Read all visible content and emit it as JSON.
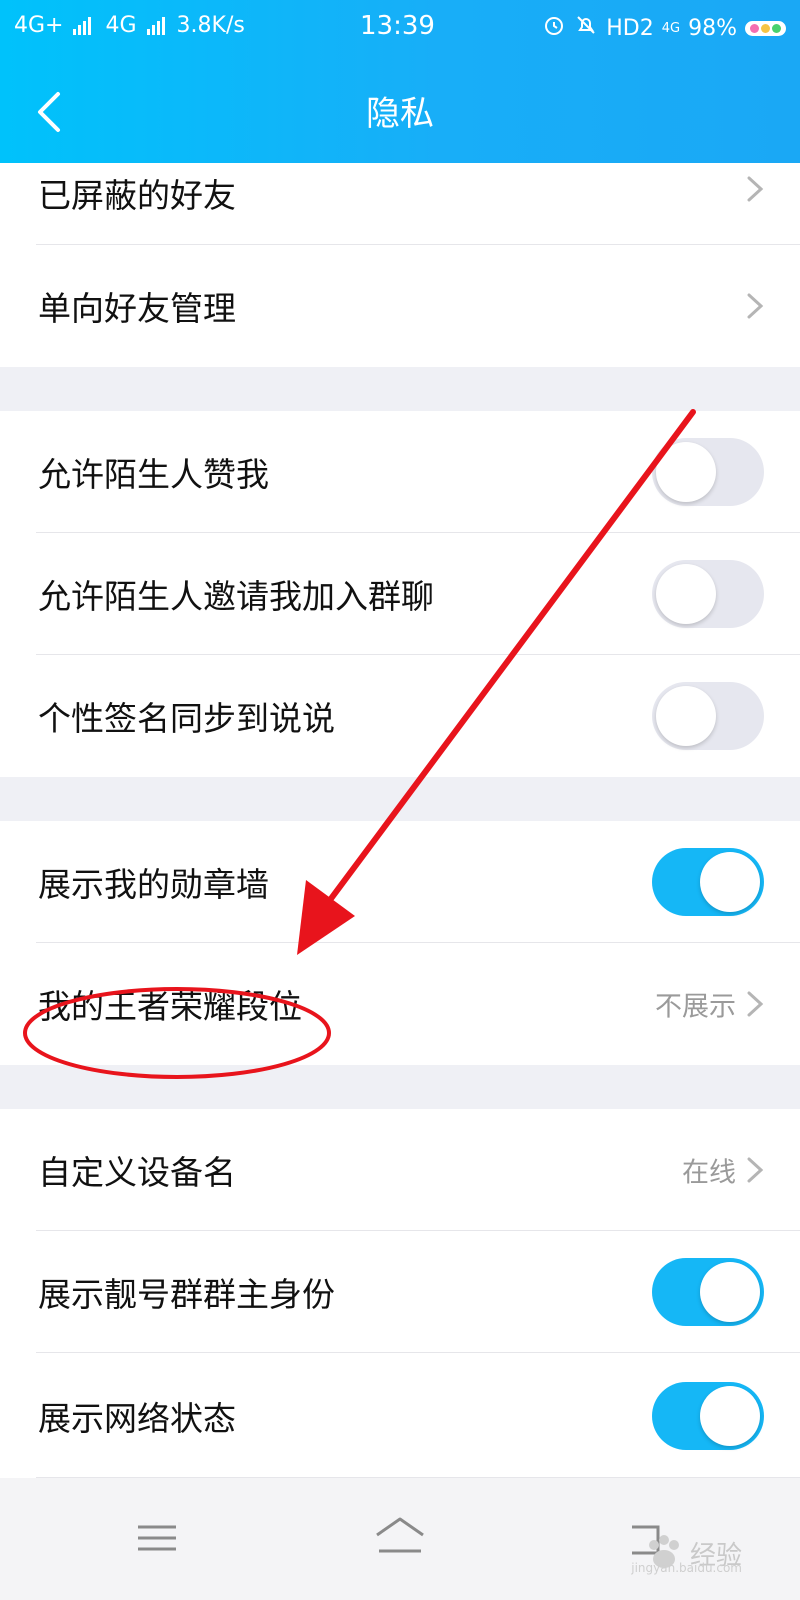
{
  "status_bar": {
    "network1": "4G+",
    "network2": "4G",
    "speed": "3.8K/s",
    "time": "13:39",
    "hd": "HD2",
    "net_small": "4G",
    "battery": "98%"
  },
  "nav": {
    "title": "隐私",
    "back_icon": "chevron-left-icon"
  },
  "rows": {
    "blocked_friends": {
      "label": "已屏蔽的好友"
    },
    "one_way_friends": {
      "label": "单向好友管理"
    },
    "allow_stranger_like": {
      "label": "允许陌生人赞我",
      "on": false
    },
    "allow_stranger_invite": {
      "label": "允许陌生人邀请我加入群聊",
      "on": false
    },
    "signature_sync": {
      "label": "个性签名同步到说说",
      "on": false
    },
    "show_medal_wall": {
      "label": "展示我的勋章墙",
      "on": true
    },
    "honor_of_kings_rank": {
      "label": "我的王者荣耀段位",
      "value": "不展示"
    },
    "custom_device_name": {
      "label": "自定义设备名",
      "value": "在线"
    },
    "show_group_owner": {
      "label": "展示靓号群群主身份",
      "on": true
    },
    "show_network_status": {
      "label": "展示网络状态",
      "on": true
    }
  },
  "colors": {
    "header_gradient_start": "#00c2fb",
    "header_gradient_end": "#1aa8f5",
    "toggle_on": "#15b7f6",
    "toggle_off": "#e6e7ef",
    "annotation_red": "#e8141c"
  },
  "bottom_nav": {
    "menu_icon": "menu-icon",
    "home_icon": "home-icon",
    "back_icon": "back-icon"
  },
  "watermark": {
    "text": "经验",
    "sub": "jingyan.baidu.com"
  }
}
